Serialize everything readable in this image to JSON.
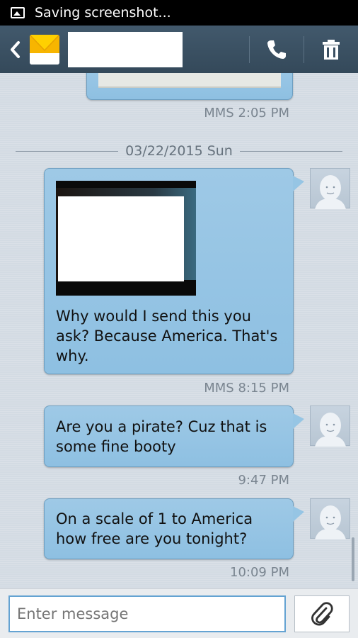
{
  "status_bar": {
    "text": "Saving screenshot...",
    "icon": "image-icon"
  },
  "action_bar": {
    "back_icon": "chevron-left-icon",
    "contact_icon": "envelope-icon",
    "call_icon": "phone-icon",
    "delete_icon": "trash-icon"
  },
  "messages": {
    "prev": {
      "meta": "MMS 2:05 PM"
    },
    "date_separator": "03/22/2015 Sun",
    "m1": {
      "text_l1": "Why would I send this you",
      "text_l2": "ask? Because America. That's",
      "text_l3": "why.",
      "meta": "MMS 8:15 PM"
    },
    "m2": {
      "text_l1": "Are you a pirate? Cuz that is",
      "text_l2": "some fine booty",
      "meta": "9:47 PM"
    },
    "m3": {
      "text_l1": "On a scale of 1 to America",
      "text_l2": "how free are you tonight?",
      "meta": "10:09 PM"
    }
  },
  "composer": {
    "placeholder": "Enter message",
    "attach_icon": "paperclip-icon"
  },
  "colors": {
    "bubble": "#96c5e4",
    "action_bar": "#3b5062",
    "input_border": "#64a3d2"
  }
}
